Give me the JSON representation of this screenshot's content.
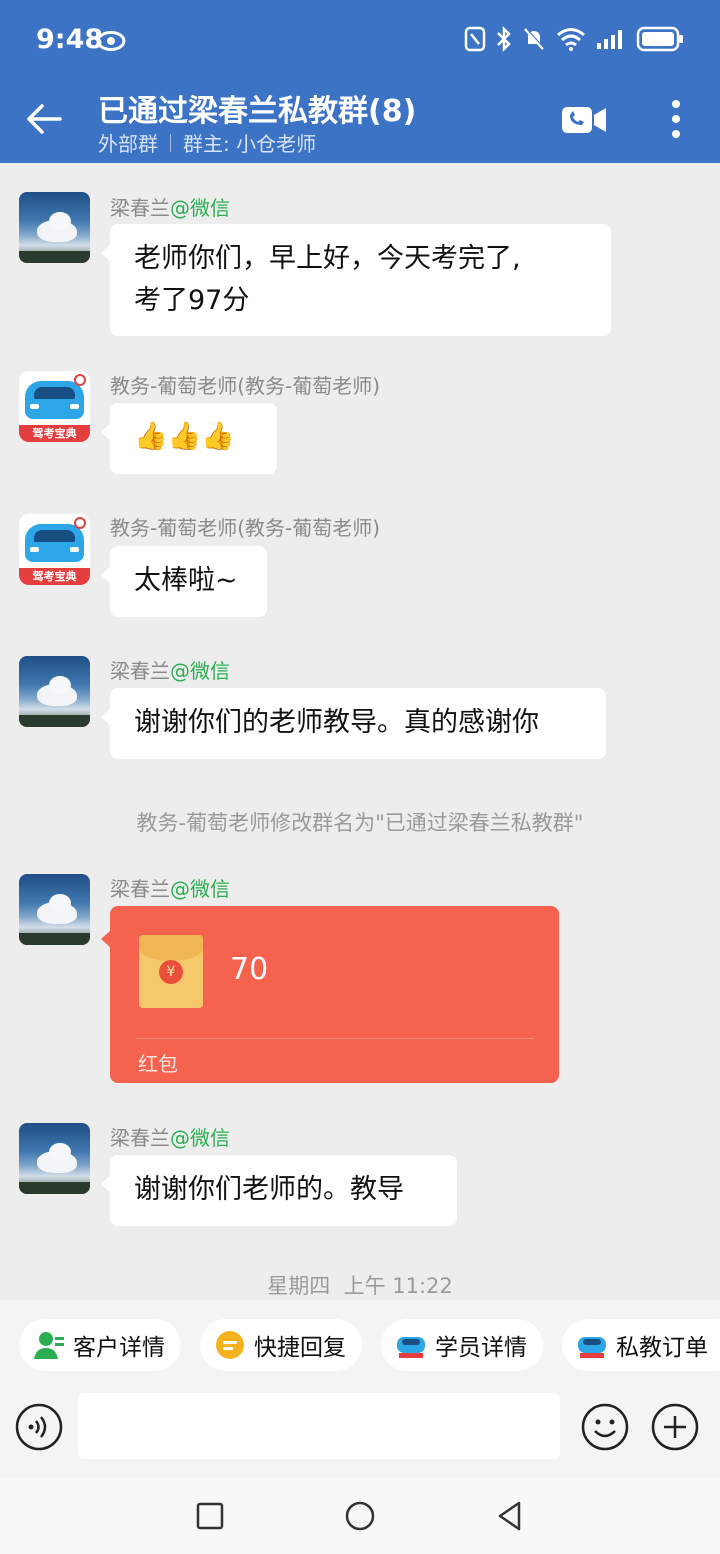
{
  "status_bar": {
    "time": "9:48"
  },
  "header": {
    "title": "已通过梁春兰私教群(8)",
    "tag": "外部群",
    "owner": "群主: 小仓老师"
  },
  "messages": [
    {
      "sender": "梁春兰",
      "sender_suffix": "@微信",
      "text_line1": "老师你们，早上好，今天考完了,",
      "text_line2": "考了97分"
    },
    {
      "sender": "教务-葡萄老师(教务-葡萄老师)",
      "text": "👍👍👍"
    },
    {
      "sender": "教务-葡萄老师(教务-葡萄老师)",
      "text": "太棒啦~"
    },
    {
      "sender": "梁春兰",
      "sender_suffix": "@微信",
      "text": "谢谢你们的老师教导。真的感谢你"
    },
    {
      "system": "教务-葡萄老师修改群名为\"已通过梁春兰私教群\""
    },
    {
      "sender": "梁春兰",
      "sender_suffix": "@微信",
      "red_packet": {
        "amount": "70",
        "label": "红包",
        "coin": "¥"
      }
    },
    {
      "sender": "梁春兰",
      "sender_suffix": "@微信",
      "text": "谢谢你们老师的。教导"
    }
  ],
  "avatar_badge": "驾考宝典",
  "timestamp": "星期四  上午 11:22",
  "quick_actions": [
    {
      "label": "客户详情",
      "icon": "customer-icon"
    },
    {
      "label": "快捷回复",
      "icon": "quick-reply-icon"
    },
    {
      "label": "学员详情",
      "icon": "student-icon"
    },
    {
      "label": "私教订单",
      "icon": "order-icon"
    }
  ],
  "input": {
    "placeholder": ""
  },
  "colors": {
    "header": "#3D73C5",
    "red_packet": "#F5634F",
    "wechat_green": "#2BAE52"
  }
}
